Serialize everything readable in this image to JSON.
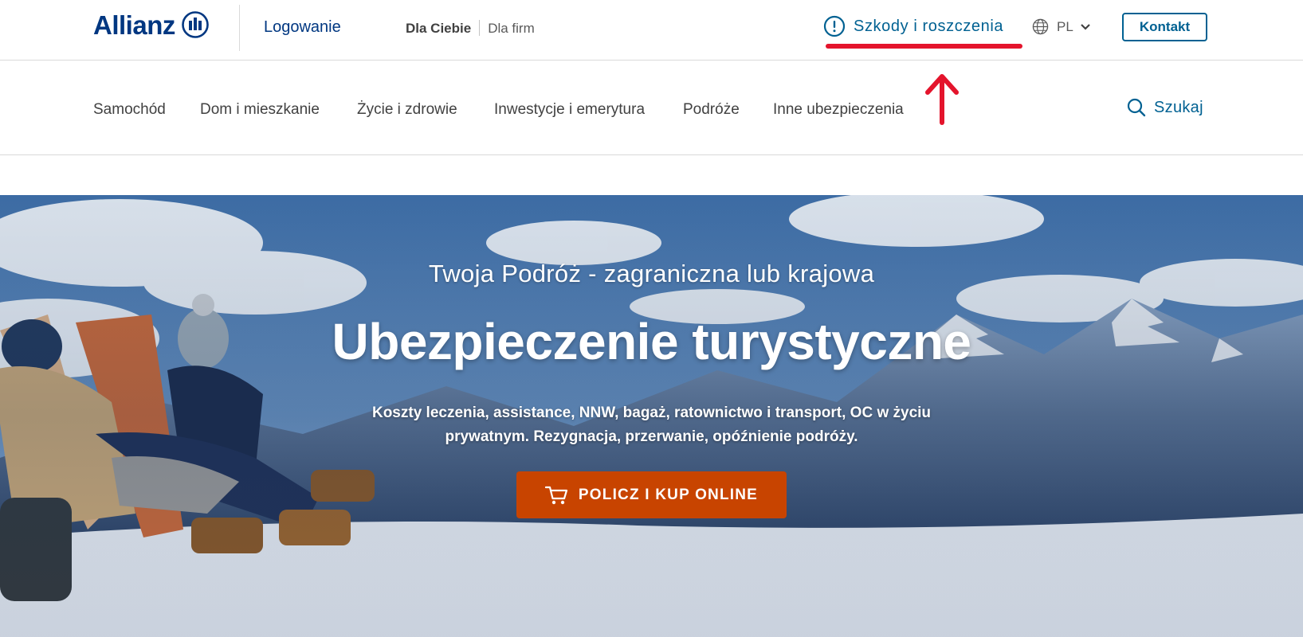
{
  "header": {
    "logo_text": "Allianz",
    "login": "Logowanie",
    "segments": {
      "personal": "Dla Ciebie",
      "business": "Dla firm"
    },
    "claims": "Szkody i roszczenia",
    "language": "PL",
    "contact": "Kontakt"
  },
  "nav": {
    "items": [
      "Samochód",
      "Dom i mieszkanie",
      "Życie i zdrowie",
      "Inwestycje i emerytura",
      "Podróże",
      "Inne ubezpieczenia"
    ],
    "search": "Szukaj"
  },
  "hero": {
    "kicker": "Twoja Podróż - zagraniczna lub krajowa",
    "title": "Ubezpieczenie turystyczne",
    "description_line1": "Koszty leczenia, assistance, NNW, bagaż, ratownictwo i  transport, OC w życiu",
    "description_line2": "prywatnym. Rezygnacja, przerwanie, opóźnienie podróży.",
    "cta": "POLICZ I KUP ONLINE"
  },
  "colors": {
    "brand_blue": "#003781",
    "link_blue": "#006192",
    "annotation_red": "#e4142c",
    "cta_orange": "#c84400"
  }
}
